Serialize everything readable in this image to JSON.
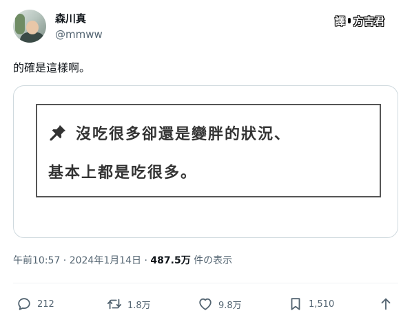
{
  "author": {
    "display_name": "森川真",
    "handle": "@mmww"
  },
  "watermark": {
    "prefix": "譯",
    "name": "方吉君"
  },
  "tweet": {
    "text": "的確是這樣啊。"
  },
  "media": {
    "line1": "沒吃很多卻還是變胖的狀況、",
    "line2": "基本上都是吃很多。",
    "pin_icon": "pushpin-icon"
  },
  "meta": {
    "time_date": "午前10:57 · 2024年1月14日 · ",
    "views_count": "487.5万",
    "views_label": " 件の表示"
  },
  "actions": {
    "reply_count": "212",
    "retweet_count": "1.8万",
    "like_count": "9.8万",
    "bookmark_count": "1,510"
  },
  "colors": {
    "text_primary": "#0f1419",
    "text_secondary": "#536471",
    "border": "#cfd9de"
  }
}
